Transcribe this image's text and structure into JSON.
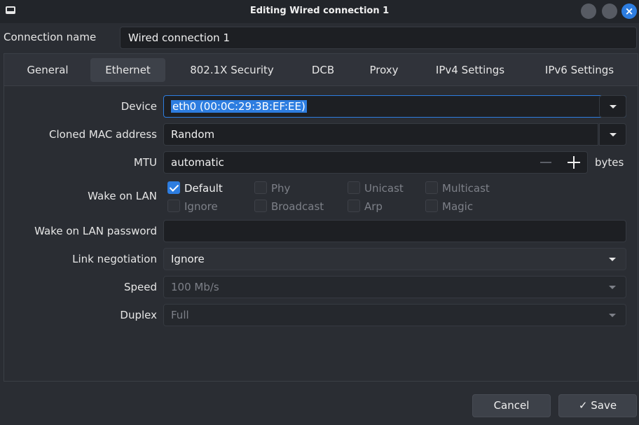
{
  "window": {
    "title": "Editing Wired connection 1",
    "controls": [
      "minimize",
      "maximize",
      "close"
    ],
    "accent": "#2d7de0"
  },
  "connection_name": {
    "label": "Connection name",
    "value": "Wired connection 1"
  },
  "tabs": [
    {
      "label": "General",
      "active": false
    },
    {
      "label": "Ethernet",
      "active": true
    },
    {
      "label": "802.1X Security",
      "active": false
    },
    {
      "label": "DCB",
      "active": false
    },
    {
      "label": "Proxy",
      "active": false
    },
    {
      "label": "IPv4 Settings",
      "active": false
    },
    {
      "label": "IPv6 Settings",
      "active": false
    }
  ],
  "ethernet": {
    "device": {
      "label": "Device",
      "value": "eth0 (00:0C:29:3B:EF:EE)"
    },
    "cloned_mac": {
      "label": "Cloned MAC address",
      "value": "Random"
    },
    "mtu": {
      "label": "MTU",
      "value": "automatic",
      "unit": "bytes"
    },
    "wake_on_lan": {
      "label": "Wake on LAN",
      "options": [
        {
          "label": "Default",
          "checked": true,
          "enabled": true
        },
        {
          "label": "Phy",
          "checked": false,
          "enabled": false
        },
        {
          "label": "Unicast",
          "checked": false,
          "enabled": false
        },
        {
          "label": "Multicast",
          "checked": false,
          "enabled": false
        },
        {
          "label": "Ignore",
          "checked": false,
          "enabled": false
        },
        {
          "label": "Broadcast",
          "checked": false,
          "enabled": false
        },
        {
          "label": "Arp",
          "checked": false,
          "enabled": false
        },
        {
          "label": "Magic",
          "checked": false,
          "enabled": false
        }
      ]
    },
    "wol_password": {
      "label": "Wake on LAN password",
      "value": ""
    },
    "link_negotiation": {
      "label": "Link negotiation",
      "value": "Ignore"
    },
    "speed": {
      "label": "Speed",
      "value": "100 Mb/s",
      "enabled": false
    },
    "duplex": {
      "label": "Duplex",
      "value": "Full",
      "enabled": false
    }
  },
  "actions": {
    "cancel": "Cancel",
    "save": "Save",
    "save_icon": "check-icon"
  }
}
